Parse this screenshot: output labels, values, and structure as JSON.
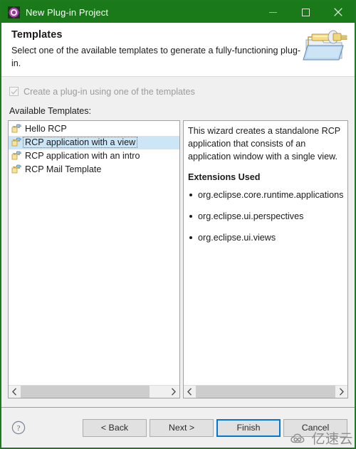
{
  "window": {
    "title": "New Plug-in Project",
    "icon": "plugin-gear-icon",
    "titlebar_color": "#1a7a1a",
    "controls": {
      "minimize": "minimize-icon",
      "maximize": "maximize-icon",
      "close": "close-icon"
    }
  },
  "header": {
    "title": "Templates",
    "description": "Select one of the available templates to generate a fully-functioning plug-in.",
    "banner_icon": "plugin-folder-icon"
  },
  "options": {
    "create_checkbox": {
      "label": "Create a plug-in using one of the templates",
      "checked": true,
      "enabled": false
    },
    "available_label": "Available Templates:"
  },
  "templates": {
    "items": [
      {
        "label": "Hello RCP",
        "selected": false,
        "icon": "plugin-icon"
      },
      {
        "label": "RCP application with a view",
        "selected": true,
        "icon": "plugin-icon"
      },
      {
        "label": "RCP application with an intro",
        "selected": false,
        "icon": "plugin-icon"
      },
      {
        "label": "RCP Mail Template",
        "selected": false,
        "icon": "plugin-icon"
      }
    ],
    "selection_color": "#cde6f7"
  },
  "description": {
    "text": "This wizard creates a standalone RCP application that consists of an application window with a single view.",
    "extensions_heading": "Extensions Used",
    "extensions": [
      "org.eclipse.core.runtime.applications",
      "org.eclipse.ui.perspectives",
      "org.eclipse.ui.views"
    ]
  },
  "scrollbars": {
    "left_arrow": "chevron-left-icon",
    "right_arrow": "chevron-right-icon"
  },
  "footer": {
    "help": "help-icon",
    "back_label": "< Back",
    "next_label": "Next >",
    "finish_label": "Finish",
    "cancel_label": "Cancel",
    "default_button": "Finish",
    "focus_color": "#0078d7"
  },
  "watermark": {
    "text": "亿速云",
    "logo": "cloud-logo-icon"
  }
}
